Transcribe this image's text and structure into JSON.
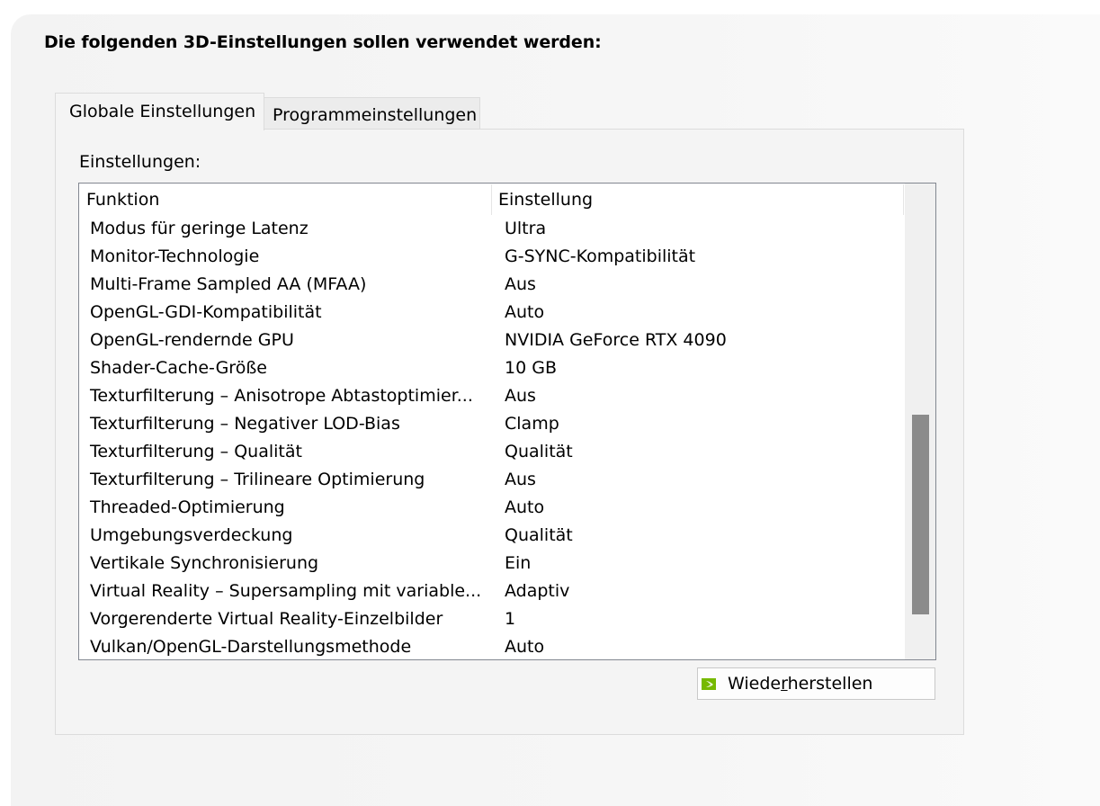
{
  "heading": "Die folgenden 3D-Einstellungen sollen verwendet werden:",
  "tabs": [
    {
      "label": "Globale Einstellungen",
      "active": true
    },
    {
      "label": "Programmeinstellungen",
      "active": false
    }
  ],
  "settings_label": "Einstellungen:",
  "table": {
    "columns": [
      "Funktion",
      "Einstellung"
    ],
    "rows": [
      {
        "function": "Modus für geringe Latenz",
        "setting": "Ultra"
      },
      {
        "function": "Monitor-Technologie",
        "setting": "G-SYNC-Kompatibilität"
      },
      {
        "function": "Multi-Frame Sampled AA (MFAA)",
        "setting": "Aus"
      },
      {
        "function": "OpenGL-GDI-Kompatibilität",
        "setting": "Auto"
      },
      {
        "function": "OpenGL-rendernde GPU",
        "setting": "NVIDIA GeForce RTX 4090"
      },
      {
        "function": "Shader-Cache-Größe",
        "setting": "10 GB"
      },
      {
        "function": "Texturfilterung – Anisotrope Abtastoptimier...",
        "setting": "Aus"
      },
      {
        "function": "Texturfilterung – Negativer LOD-Bias",
        "setting": "Clamp"
      },
      {
        "function": "Texturfilterung – Qualität",
        "setting": "Qualität"
      },
      {
        "function": "Texturfilterung – Trilineare Optimierung",
        "setting": "Aus"
      },
      {
        "function": "Threaded-Optimierung",
        "setting": "Auto"
      },
      {
        "function": "Umgebungsverdeckung",
        "setting": "Qualität"
      },
      {
        "function": "Vertikale Synchronisierung",
        "setting": "Ein"
      },
      {
        "function": "Virtual Reality – Supersampling mit variable...",
        "setting": "Adaptiv"
      },
      {
        "function": "Vorgerenderte Virtual Reality-Einzelbilder",
        "setting": "1"
      },
      {
        "function": "Vulkan/OpenGL-Darstellungsmethode",
        "setting": "Auto"
      }
    ]
  },
  "restore_button": {
    "label_pre": "Wiede",
    "label_mnemonic": "r",
    "label_post": "herstellen",
    "icon": "nvidia-logo-icon"
  },
  "colors": {
    "nvidia_green": "#76b900",
    "scroll_thumb": "#8b8b8b"
  }
}
